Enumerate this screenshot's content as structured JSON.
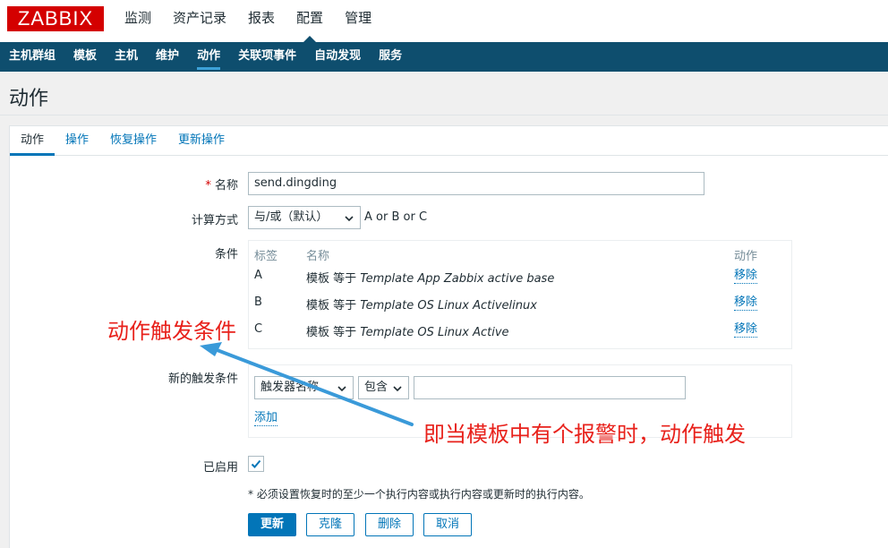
{
  "logo": "ZABBIX",
  "main_menu": [
    "监测",
    "资产记录",
    "报表",
    "配置",
    "管理"
  ],
  "sub_menu": [
    "主机群组",
    "模板",
    "主机",
    "维护",
    "动作",
    "关联项事件",
    "自动发现",
    "服务"
  ],
  "page_title": "动作",
  "tabs": [
    "动作",
    "操作",
    "恢复操作",
    "更新操作"
  ],
  "form": {
    "name_label": "名称",
    "name_required_mark": "*",
    "name_value": "send.dingding",
    "calc_label": "计算方式",
    "calc_value": "与/或（默认）",
    "calc_formula": "A or B or C",
    "conditions_label": "条件",
    "conditions_headers": {
      "label": "标签",
      "name": "名称",
      "action": "动作"
    },
    "conditions": [
      {
        "label": "A",
        "prefix": "模板 等于",
        "value": "Template App Zabbix active base",
        "action": "移除"
      },
      {
        "label": "B",
        "prefix": "模板 等于",
        "value": "Template OS Linux Activelinux",
        "action": "移除"
      },
      {
        "label": "C",
        "prefix": "模板 等于",
        "value": "Template OS Linux Active",
        "action": "移除"
      }
    ],
    "new_condition_label": "新的触发条件",
    "new_condition_type": "触发器名称",
    "new_condition_operator": "包含",
    "new_condition_value": "",
    "add_link": "添加",
    "enabled_label": "已启用",
    "enabled": true,
    "note": "* 必须设置恢复时的至少一个执行内容或执行内容或更新时的执行内容。"
  },
  "buttons": {
    "update": "更新",
    "clone": "克隆",
    "delete": "删除",
    "cancel": "取消"
  },
  "annotations": {
    "left": "动作触发条件",
    "right": "即当模板中有个报警时，动作触发",
    "color": "#e8211b",
    "arrow_color": "#3a9ad9"
  },
  "colors": {
    "brand": "#d40000",
    "submenu_bg": "#0e4e6e",
    "link": "#0275b8"
  }
}
